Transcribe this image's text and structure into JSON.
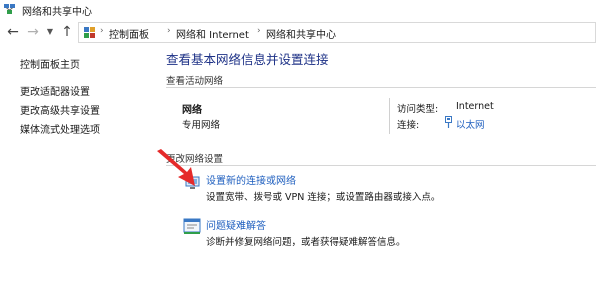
{
  "window": {
    "title": "网络和共享中心"
  },
  "nav": {
    "breadcrumbs": [
      "控制面板",
      "网络和 Internet",
      "网络和共享中心"
    ]
  },
  "sidebar": {
    "items": [
      {
        "label": "控制面板主页"
      },
      {
        "label": "更改适配器设置"
      },
      {
        "label": "更改高级共享设置"
      },
      {
        "label": "媒体流式处理选项"
      }
    ]
  },
  "main": {
    "heading": "查看基本网络信息并设置连接",
    "active_networks": {
      "section_label": "查看活动网络",
      "network_name": "网络",
      "network_type": "专用网络",
      "access_type_label": "访问类型:",
      "access_type_value": "Internet",
      "connection_label": "连接:",
      "connection_value": "以太网"
    },
    "change_settings": {
      "section_label": "更改网络设置",
      "tasks": [
        {
          "link": "设置新的连接或网络",
          "desc": "设置宽带、拨号或 VPN 连接；或设置路由器或接入点。"
        },
        {
          "link": "问题疑难解答",
          "desc": "诊断并修复网络问题，或者获得疑难解答信息。"
        }
      ]
    }
  },
  "colors": {
    "heading": "#1e3287",
    "link": "#1f5fbf",
    "annotation_arrow": "#e52a2a"
  }
}
